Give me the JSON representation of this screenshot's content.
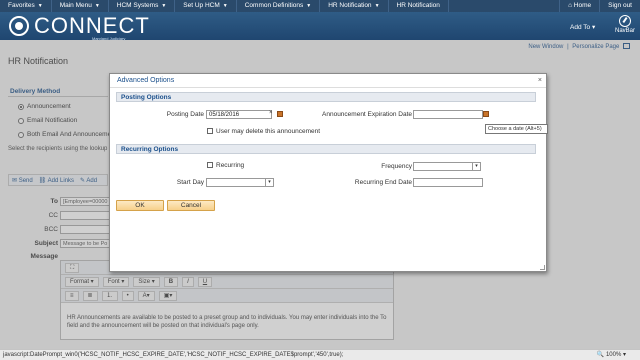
{
  "topmenu": {
    "items": [
      {
        "label": "Favorites"
      },
      {
        "label": "Main Menu"
      },
      {
        "label": "HCM Systems"
      },
      {
        "label": "Set Up HCM"
      },
      {
        "label": "Common Definitions"
      },
      {
        "label": "HR Notification"
      },
      {
        "label": "HR Notification"
      }
    ],
    "home": "Home",
    "signout": "Sign out"
  },
  "header": {
    "brand": "CONNECT",
    "sub": "Maryland Judiciary",
    "addto": "Add To",
    "navbar": "NavBar",
    "bg_color": "#2f5c86"
  },
  "page": {
    "new_window": "New Window",
    "separator": "|",
    "personalize": "Personalize Page",
    "title": "HR Notification",
    "delivery_method": "Delivery Method",
    "radios": [
      {
        "label": "Announcement",
        "checked": true
      },
      {
        "label": "Email Notification",
        "checked": false
      },
      {
        "label": "Both Email And Announcement",
        "checked": false
      }
    ],
    "hint": "Select the recipients using the lookup",
    "toolbar": {
      "send": "Send",
      "add_links": "Add Links",
      "add": "Add"
    },
    "fields": {
      "to_label": "To",
      "to_value": "[Employee=00000",
      "cc_label": "CC",
      "bcc_label": "BCC",
      "subject_label": "Subject",
      "subject_value": "Message to be Po",
      "message_label": "Message"
    },
    "editor": {
      "format": "Format",
      "font": "Font",
      "size": "Size",
      "bold": "B",
      "italic": "I",
      "underline": "U",
      "text": "HR Announcements are available to be posted to a preset group and to individuals. You may enter individuals into the To field and the announcement will be posted on that individual's page only."
    }
  },
  "modal": {
    "title": "Advanced Options",
    "close": "×",
    "posting_section": "Posting Options",
    "posting_date_label": "Posting Date",
    "posting_date_value": "05/18/2016",
    "clear": "×",
    "expiration_label": "Announcement Expiration Date",
    "expiration_value": "",
    "user_delete_label": "User may delete this announcement",
    "recurring_section": "Recurring Options",
    "recurring_label": "Recurring",
    "frequency_label": "Frequency",
    "start_day_label": "Start Day",
    "recurring_end_label": "Recurring End Date",
    "ok": "OK",
    "cancel": "Cancel",
    "tooltip": "Choose a date (Alt+5)"
  },
  "status": {
    "text": "javascript:DatePrompt_win0('HCSC_NOTIF_HCSC_EXPIRE_DATE','HCSC_NOTIF_HCSC_EXPIRE_DATE$prompt','450',true);",
    "zoom": "100%"
  }
}
